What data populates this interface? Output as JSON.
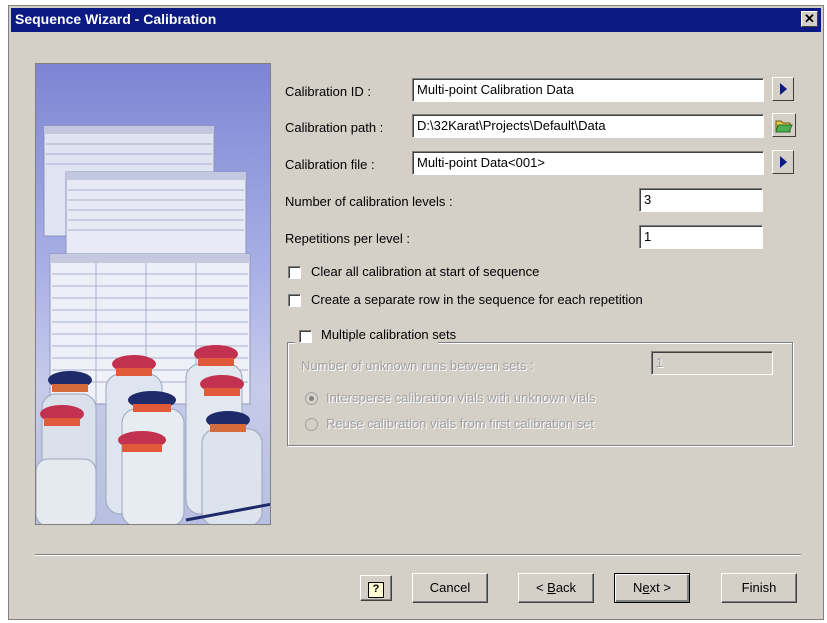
{
  "window": {
    "title": "Sequence Wizard - Calibration",
    "close_glyph": "✕"
  },
  "form": {
    "calibration_id_label": "Calibration ID :",
    "calibration_id_value": "Multi-point Calibration Data",
    "calibration_path_label": "Calibration path :",
    "calibration_path_value": "D:\\32Karat\\Projects\\Default\\Data",
    "calibration_file_label": "Calibration file :",
    "calibration_file_value": "Multi-point Data<001>",
    "levels_label": "Number of calibration levels :",
    "levels_value": "3",
    "repetitions_label": "Repetitions per level :",
    "repetitions_value": "1",
    "clear_all_label": "Clear all calibration at start of sequence",
    "separate_row_label": "Create a separate row in the sequence for each repetition",
    "multiple_sets_label": "Multiple calibration sets",
    "unknown_runs_label": "Number of unknown runs between sets :",
    "unknown_runs_value": "1",
    "intersperse_label": "Intersperse calibration vials with unknown vials",
    "reuse_label": "Reuse calibration vials from first calibration set"
  },
  "icons": {
    "arrow_right": "arrow-right-icon",
    "folder_open": "folder-open-icon",
    "help": "help-icon"
  },
  "buttons": {
    "help_glyph": "?",
    "cancel": "Cancel",
    "back_prefix": "< ",
    "back_mnemonic": "B",
    "back_rest": "ack",
    "next_prefix": "N",
    "next_mnemonic": "e",
    "next_rest": "xt >",
    "finish": "Finish"
  },
  "colors": {
    "titlebar": "#0a1a82",
    "face": "#d4d0c8",
    "accent_arrow": "#0a1a82"
  }
}
